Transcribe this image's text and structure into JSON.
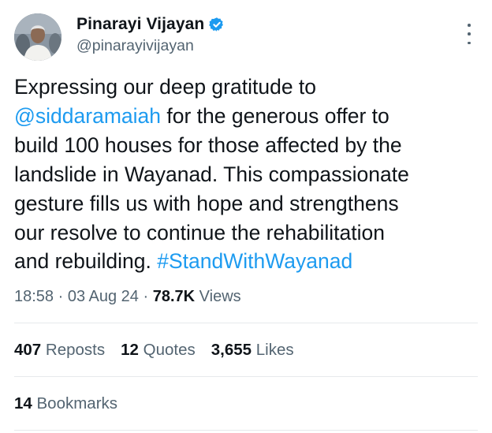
{
  "author": {
    "display_name": "Pinarayi Vijayan",
    "handle": "@pinarayivijayan",
    "avatar_icon": "profile-photo",
    "verified_icon": "verified-badge-icon"
  },
  "tweet": {
    "lines": [
      {
        "parts": [
          {
            "text": "Expressing our deep gratitude to",
            "link": false
          }
        ]
      },
      {
        "parts": [
          {
            "text": "@siddaramaiah",
            "link": true
          },
          {
            "text": " for the generous offer to",
            "link": false
          }
        ]
      },
      {
        "parts": [
          {
            "text": "build 100 houses for those affected by the",
            "link": false
          }
        ]
      },
      {
        "parts": [
          {
            "text": "landslide in Wayanad. This compassionate",
            "link": false
          }
        ]
      },
      {
        "parts": [
          {
            "text": "gesture fills us with hope and strengthens",
            "link": false
          }
        ]
      },
      {
        "parts": [
          {
            "text": "our resolve to continue the rehabilitation",
            "link": false
          }
        ]
      },
      {
        "parts": [
          {
            "text": "and rebuilding. ",
            "link": false
          },
          {
            "text": "#StandWithWayanad",
            "link": true
          }
        ]
      }
    ]
  },
  "meta": {
    "time": "18:58",
    "separator": " · ",
    "date": "03 Aug 24",
    "views_count": "78.7K",
    "views_label": " Views"
  },
  "stats": {
    "reposts_count": "407",
    "reposts_label": " Reposts",
    "quotes_count": "12",
    "quotes_label": " Quotes",
    "likes_count": "3,655",
    "likes_label": " Likes",
    "bookmarks_count": "14",
    "bookmarks_label": " Bookmarks"
  },
  "colors": {
    "link": "#1d9bf0",
    "verified": "#1d9bf0",
    "secondary_text": "#536471",
    "primary_text": "#0f1419"
  }
}
